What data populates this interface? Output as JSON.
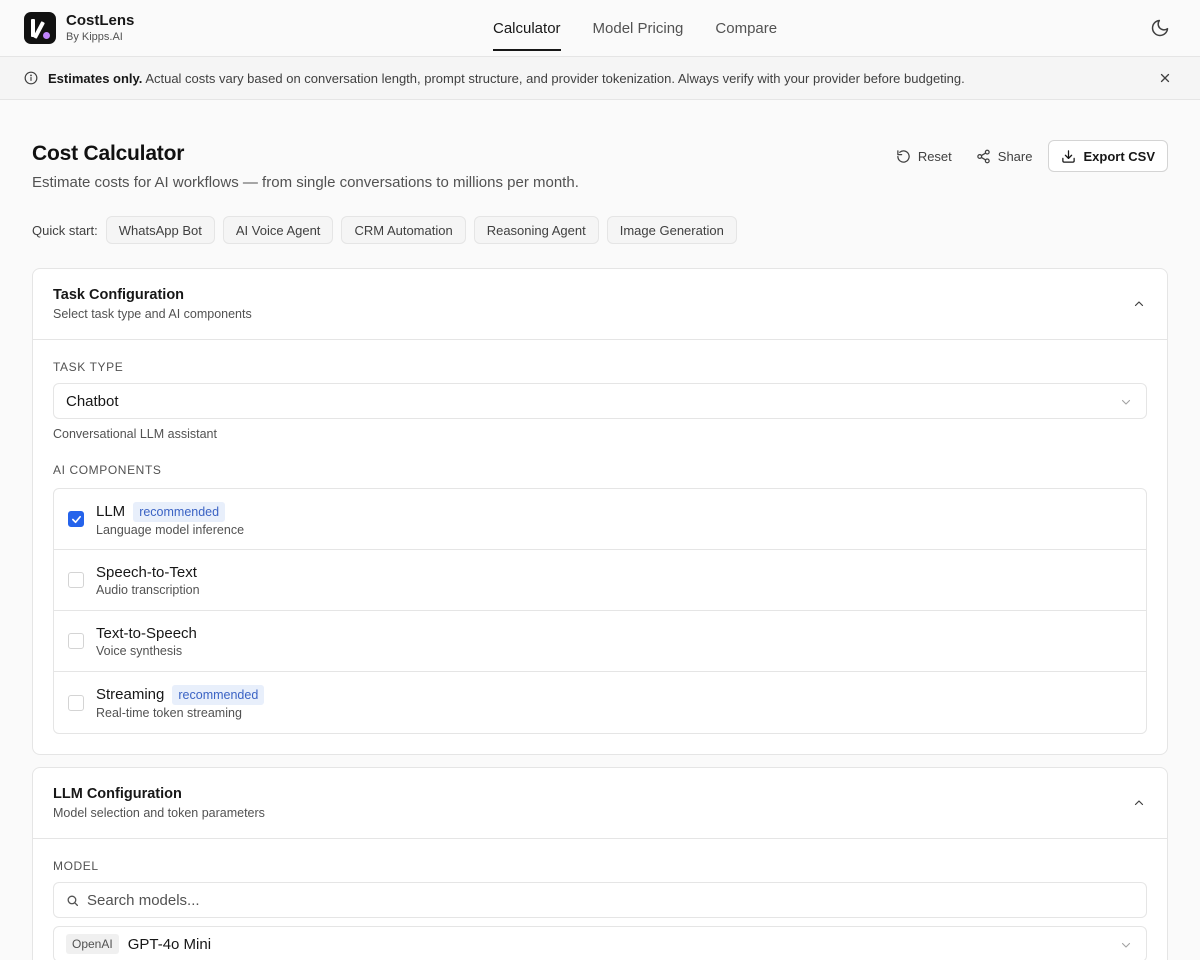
{
  "brand": {
    "name": "CostLens",
    "sub": "By Kipps.AI"
  },
  "nav": {
    "tabs": [
      {
        "label": "Calculator",
        "active": true
      },
      {
        "label": "Model Pricing"
      },
      {
        "label": "Compare"
      }
    ]
  },
  "banner": {
    "bold": "Estimates only.",
    "text": "Actual costs vary based on conversation length, prompt structure, and provider tokenization. Always verify with your provider before budgeting."
  },
  "page": {
    "title": "Cost Calculator",
    "subtitle": "Estimate costs for AI workflows — from single conversations to millions per month.",
    "actions": {
      "reset": "Reset",
      "share": "Share",
      "export": "Export CSV"
    }
  },
  "quick_start": {
    "label": "Quick start:",
    "items": [
      "WhatsApp Bot",
      "AI Voice Agent",
      "CRM Automation",
      "Reasoning Agent",
      "Image Generation"
    ]
  },
  "task_config": {
    "title": "Task Configuration",
    "subtitle": "Select task type and AI components",
    "task_type_label": "Task Type",
    "task_type_value": "Chatbot",
    "task_type_help": "Conversational LLM assistant",
    "components_label": "AI Components",
    "components": [
      {
        "name": "LLM",
        "badge": "recommended",
        "desc": "Language model inference",
        "checked": true
      },
      {
        "name": "Speech-to-Text",
        "badge": "",
        "desc": "Audio transcription",
        "checked": false
      },
      {
        "name": "Text-to-Speech",
        "badge": "",
        "desc": "Voice synthesis",
        "checked": false
      },
      {
        "name": "Streaming",
        "badge": "recommended",
        "desc": "Real-time token streaming",
        "checked": false
      }
    ]
  },
  "llm_config": {
    "title": "LLM Configuration",
    "subtitle": "Model selection and token parameters",
    "model_label": "Model",
    "search_placeholder": "Search models...",
    "selected_provider": "OpenAI",
    "selected_model": "GPT-4o Mini"
  },
  "colors": {
    "accent": "#2563eb",
    "badge_bg": "#e8effb",
    "badge_text": "#3b63c4"
  }
}
